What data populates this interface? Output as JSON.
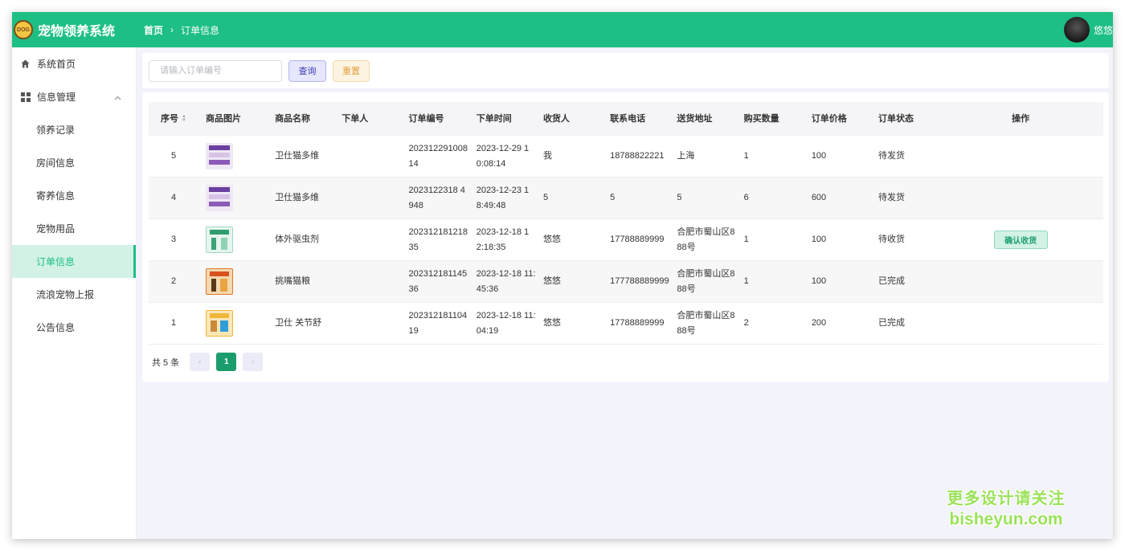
{
  "header": {
    "logo_text": "DOG",
    "app_title": "宠物领养系统",
    "breadcrumb": {
      "home": "首页",
      "current": "订单信息"
    },
    "username": "悠悠"
  },
  "sidebar": {
    "items": [
      {
        "label": "系统首页"
      },
      {
        "label": "信息管理"
      },
      {
        "label": "领养记录"
      },
      {
        "label": "房间信息"
      },
      {
        "label": "寄养信息"
      },
      {
        "label": "宠物用品"
      },
      {
        "label": "订单信息"
      },
      {
        "label": "流浪宠物上报"
      },
      {
        "label": "公告信息"
      }
    ]
  },
  "search": {
    "placeholder": "请输入订单编号",
    "value": "",
    "query_label": "查询",
    "reset_label": "重置"
  },
  "table": {
    "columns": [
      "序号",
      "商品图片",
      "商品名称",
      "下单人",
      "订单编号",
      "下单时间",
      "收货人",
      "联系电话",
      "送货地址",
      "购买数量",
      "订单价格",
      "订单状态",
      "操作"
    ],
    "rows": [
      {
        "idx": "5",
        "name": "卫仕猫多维",
        "user": "",
        "order_no": "20231229100814",
        "time": "2023-12-29 10:08:14",
        "receiver": "我",
        "phone": "18788822221",
        "address": "上海",
        "qty": "1",
        "price": "100",
        "status": "待发货",
        "action": ""
      },
      {
        "idx": "4",
        "name": "卫仕猫多维",
        "user": "",
        "order_no": "2023122318 4948",
        "time": "2023-12-23 18:49:48",
        "receiver": "5",
        "phone": "5",
        "address": "5",
        "qty": "6",
        "price": "600",
        "status": "待发货",
        "action": ""
      },
      {
        "idx": "3",
        "name": "体外驱虫剂",
        "user": "",
        "order_no": "20231218121835",
        "time": "2023-12-18 12:18:35",
        "receiver": "悠悠",
        "phone": "17788889999",
        "address": "合肥市蜀山区888号",
        "qty": "1",
        "price": "100",
        "status": "待收货",
        "action": "确认收货"
      },
      {
        "idx": "2",
        "name": "挑嘴猫粮",
        "user": "",
        "order_no": "20231218114536",
        "time": "2023-12-18 11:45:36",
        "receiver": "悠悠",
        "phone": "177788889999",
        "address": "合肥市蜀山区888号",
        "qty": "1",
        "price": "100",
        "status": "已完成",
        "action": ""
      },
      {
        "idx": "1",
        "name": "卫仕 关节舒",
        "user": "",
        "order_no": "20231218110419",
        "time": "2023-12-18 11:04:19",
        "receiver": "悠悠",
        "phone": "17788889999",
        "address": "合肥市蜀山区888号",
        "qty": "2",
        "price": "200",
        "status": "已完成",
        "action": ""
      }
    ]
  },
  "pagination": {
    "total_text": "共 5 条",
    "prev": "‹",
    "current": "1",
    "next": "›"
  },
  "watermark": {
    "line1": "更多设计请关注",
    "line2": "bisheyun.com"
  },
  "colors": {
    "primary": "#1dbf84",
    "active_menu_bg": "#d2f2e6",
    "page_bg": "#f2f3fb"
  }
}
